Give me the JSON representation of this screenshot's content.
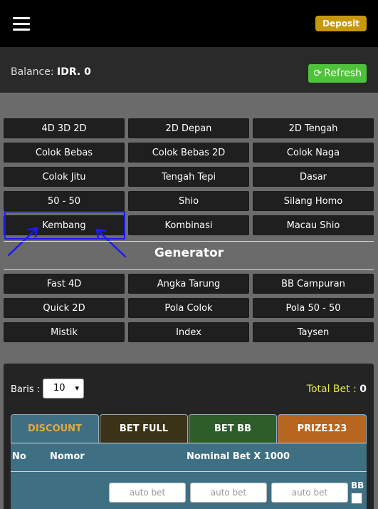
{
  "header": {
    "deposit_label": "Deposit"
  },
  "balance": {
    "label": "Balance:",
    "value": "IDR. 0",
    "refresh_label": "Refresh"
  },
  "games": [
    "4D 3D 2D",
    "2D Depan",
    "2D Tengah",
    "Colok Bebas",
    "Colok Bebas 2D",
    "Colok Naga",
    "Colok Jitu",
    "Tengah Tepi",
    "Dasar",
    "50 - 50",
    "Shio",
    "Silang Homo",
    "Kembang",
    "Kombinasi",
    "Macau Shio"
  ],
  "generator": {
    "title": "Generator",
    "items": [
      "Fast 4D",
      "Angka Tarung",
      "BB Campuran",
      "Quick 2D",
      "Pola Colok",
      "Pola 50 - 50",
      "Mistik",
      "Index",
      "Taysen"
    ]
  },
  "bet": {
    "baris_label": "Baris :",
    "baris_value": "10",
    "total_label": "Total Bet :",
    "total_value": "0",
    "tabs": [
      "DISCOUNT",
      "BET FULL",
      "BET BB",
      "PRIZE123"
    ],
    "columns": [
      "No",
      "Nomor",
      "Nominal Bet X 1000"
    ],
    "placeholder": "auto bet",
    "bb_label": "BB"
  },
  "colors": {
    "deposit": "#c7970e",
    "refresh": "#4ec33a",
    "highlight": "#1a1aff",
    "tab_discount": "#3f6f82",
    "tab_betfull": "#3b3317",
    "tab_betbb": "#2e5d2a",
    "tab_prize": "#b8661f"
  }
}
